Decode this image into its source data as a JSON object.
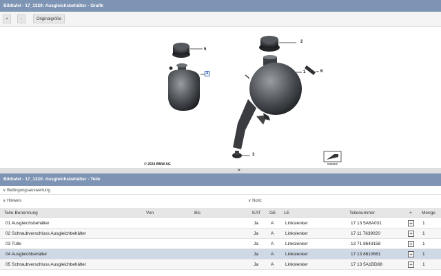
{
  "graphic": {
    "title": "Bildtafel - 17_1320: Ausgleichsbehälter - Grafik",
    "toolbar": {
      "zoom_in": "+",
      "zoom_out": "-",
      "original": "Originalgröße"
    },
    "copyright": "© 2024 BMW AG",
    "image_id": "539902",
    "callouts": [
      "1",
      "2",
      "3",
      "4",
      "5",
      "6"
    ]
  },
  "parts": {
    "title": "Bildtafel - 17_1320: Ausgleichsbehälter - Teile",
    "sections": {
      "conditions": "Bedingungsauswertung",
      "hint": "Hinweis",
      "note": "Notiz"
    },
    "columns": {
      "name": "Teile-Benennung",
      "from": "Von",
      "to": "Bis",
      "kat": "KAT",
      "ge": "GE",
      "le": "LE",
      "number": "Teilenummer",
      "plus": "+",
      "qty": "Menge"
    },
    "rows": [
      {
        "name": "01 Ausgleichsbehälter",
        "kat": "Ja",
        "ge": "A",
        "le": "Linkslenker",
        "number": "17 13 5A6A031",
        "qty": "1"
      },
      {
        "name": "02 Schraubverschluss Ausgleichbehälter",
        "kat": "Ja",
        "ge": "A",
        "le": "Linkslenker",
        "number": "17 11 7639020",
        "qty": "1"
      },
      {
        "name": "03 Tülle",
        "kat": "Ja",
        "ge": "A",
        "le": "Linkslenker",
        "number": "13 71 8643158",
        "qty": "1"
      },
      {
        "name": "04 Ausgleichbehälter",
        "kat": "Ja",
        "ge": "A",
        "le": "Linkslenker",
        "number": "17 13 8610661",
        "qty": "1"
      },
      {
        "name": "05 Schraubverschluss Ausgleichbehälter",
        "kat": "Ja",
        "ge": "A",
        "le": "Linkslenker",
        "number": "17 13 5A1BD88",
        "qty": "1"
      }
    ]
  }
}
